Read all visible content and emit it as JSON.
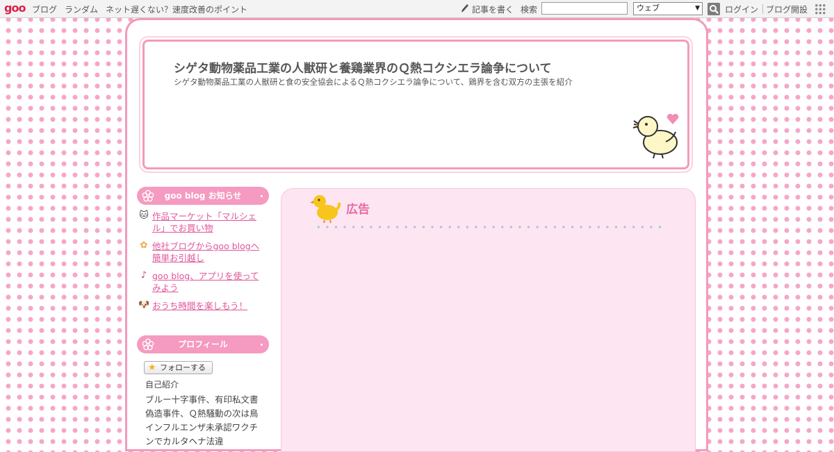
{
  "topbar": {
    "logo": "goo",
    "nav": [
      "ブログ",
      "ランダム",
      "ネット遅くない？速度改善のポイント"
    ],
    "write_label": "記事を書く",
    "search_label": "検索",
    "search_value": "",
    "scope_selected": "ウェブ",
    "login_label": "ログイン",
    "open_blog_label": "ブログ開設"
  },
  "header": {
    "title": "シゲタ動物薬品工業の人獣研と養鶏業界のＱ熱コクシエラ論争について",
    "description": "シゲタ動物薬品工業の人獣研と食の安全協会によるＱ熱コクシエラ論争について、鶏界を含む双方の主張を紹介"
  },
  "sidebar": {
    "news_heading": "goo blog お知らせ",
    "news_items": [
      {
        "icon": "cat-face-icon",
        "label": "作品マーケット「マルシェル」でお買い物"
      },
      {
        "icon": "flower-icon",
        "label": "他社ブログからgoo blogへ簡単お引越し"
      },
      {
        "icon": "music-note-icon",
        "label": "goo blog、アプリを使ってみよう"
      },
      {
        "icon": "dog-face-icon",
        "label": "おうち時間を楽しもう！"
      }
    ],
    "profile_heading": "プロフィール",
    "follow_label": "フォローする",
    "self_intro_label": "自己紹介",
    "profile_text": "ブルー十字事件、有印私文書偽造事件、Ｑ熱騒動の次は鳥インフルエンザ未承認ワクチンでカルタヘナ法違"
  },
  "main": {
    "ad_heading": "広告"
  },
  "colors": {
    "accent_pink": "#f39abb",
    "link_pink": "#e0559a",
    "panel_bg": "#fde6f1"
  }
}
